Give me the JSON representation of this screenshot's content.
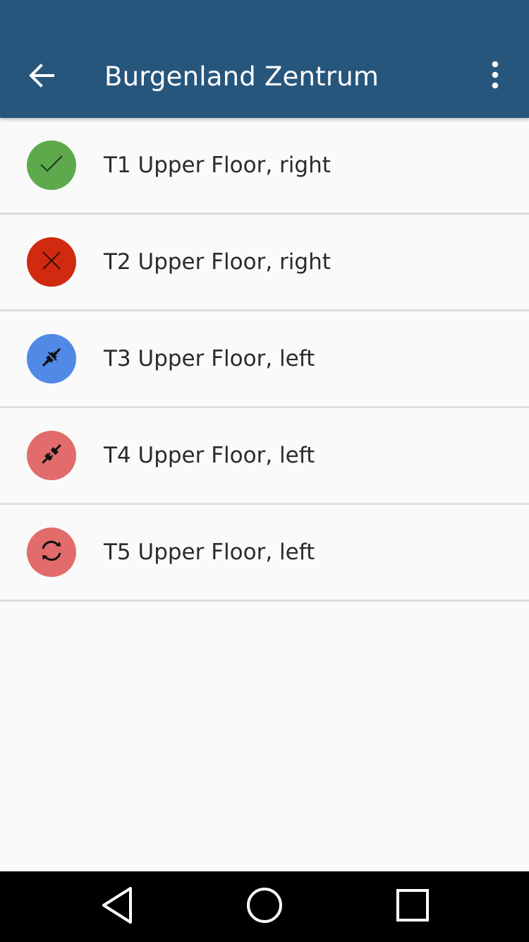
{
  "appbar": {
    "title": "Burgenland Zentrum",
    "background": "#27567d",
    "back_icon": "arrow-back-icon",
    "menu_icon": "more-vert-icon"
  },
  "terminals": [
    {
      "label": "T1 Upper Floor, right",
      "status": "ok",
      "icon": "check-icon",
      "color": "#5ea94c"
    },
    {
      "label": "T2 Upper Floor, right",
      "status": "error",
      "icon": "close-icon",
      "color": "#d12a10"
    },
    {
      "label": "T3 Upper Floor, left",
      "status": "connected",
      "icon": "plug-icon",
      "color": "#5089e6"
    },
    {
      "label": "T4 Upper Floor, left",
      "status": "disconnected",
      "icon": "plug-icon",
      "color": "#e26b6b"
    },
    {
      "label": "T5 Upper Floor, left",
      "status": "syncing",
      "icon": "sync-icon",
      "color": "#e26b6b"
    }
  ],
  "navbar": {
    "back_icon": "nav-back-icon",
    "home_icon": "nav-home-icon",
    "recents_icon": "nav-recents-icon"
  }
}
